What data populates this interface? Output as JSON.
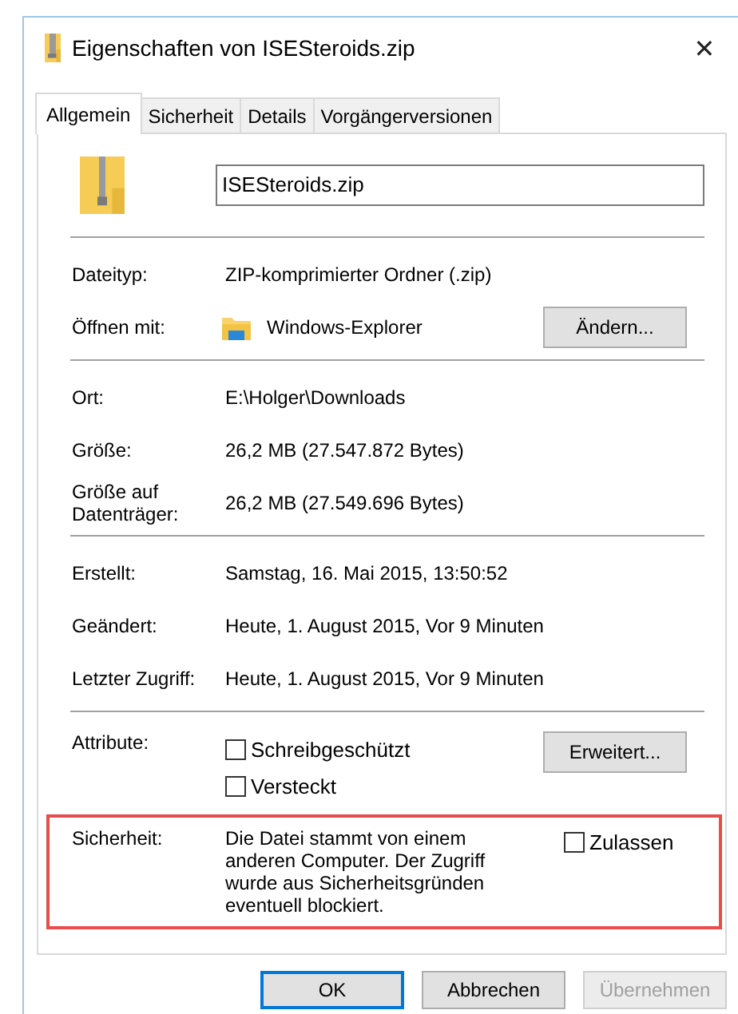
{
  "window": {
    "title": "Eigenschaften von ISESteroids.zip",
    "close": "✕"
  },
  "tabs": [
    {
      "label": "Allgemein",
      "selected": true
    },
    {
      "label": "Sicherheit",
      "selected": false
    },
    {
      "label": "Details",
      "selected": false
    },
    {
      "label": "Vorgängerversionen",
      "selected": false
    }
  ],
  "file_name": {
    "value": "ISESteroids.zip"
  },
  "sections": [
    [
      {
        "kind": "text",
        "label": "Dateityp:",
        "value": "ZIP-komprimierter Ordner (.zip)"
      },
      {
        "kind": "app",
        "label": "Öffnen mit:",
        "value": "Windows-Explorer",
        "button": "Ändern..."
      }
    ],
    [
      {
        "kind": "text",
        "label": "Ort:",
        "value": "E:\\Holger\\Downloads"
      },
      {
        "kind": "text",
        "label": "Größe:",
        "value": "26,2 MB (27.547.872 Bytes)"
      },
      {
        "kind": "text",
        "label": "Größe auf Datenträger:",
        "value": "26,2 MB (27.549.696 Bytes)"
      }
    ],
    [
      {
        "kind": "text",
        "label": "Erstellt:",
        "value": "Samstag, 16. Mai 2015, 13:50:52"
      },
      {
        "kind": "text",
        "label": "Geändert:",
        "value": "Heute, 1. August 2015, Vor 9 Minuten"
      },
      {
        "kind": "text",
        "label": "Letzter Zugriff:",
        "value": "Heute, 1. August 2015, Vor 9 Minuten"
      }
    ],
    [
      {
        "kind": "attributes",
        "label": "Attribute:",
        "checkboxes": [
          {
            "label": "Schreibgeschützt",
            "checked": false
          },
          {
            "label": "Versteckt",
            "checked": false
          }
        ],
        "button": "Erweitert..."
      }
    ]
  ],
  "security": {
    "label": "Sicherheit:",
    "text": "Die Datei stammt von einem anderen Computer. Der Zugriff wurde aus Sicherheitsgründen eventuell blockiert.",
    "checkbox": {
      "label": "Zulassen",
      "checked": false
    },
    "highlighted": true
  },
  "buttons": [
    {
      "label": "OK",
      "default": true,
      "disabled": false
    },
    {
      "label": "Abbrechen",
      "default": false,
      "disabled": false
    },
    {
      "label": "Übernehmen",
      "default": false,
      "disabled": true
    }
  ]
}
